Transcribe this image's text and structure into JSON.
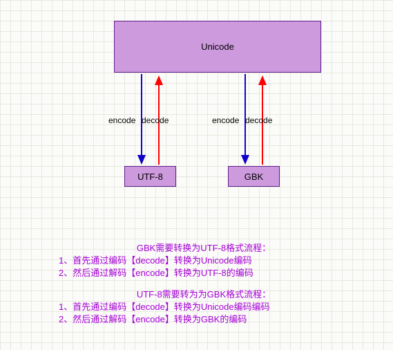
{
  "boxes": {
    "unicode": "Unicode",
    "utf8": "UTF-8",
    "gbk": "GBK"
  },
  "arrow_labels": {
    "encode_left": "encode",
    "decode_left": "decode",
    "encode_right": "encode",
    "decode_right": "decode"
  },
  "notes": {
    "section1_title": "GBK需要转换为UTF-8格式流程：",
    "section1_line1": "1、首先通过编码【decode】转换为Unicode编码",
    "section1_line2": "2、然后通过解码【encode】转换为UTF-8的编码",
    "section2_title": "UTF-8需要转为为GBK格式流程：",
    "section2_line1": "1、首先通过编码【decode】转换为Unicode编码编码",
    "section2_line2": "2、然后通过解码【encode】转换为GBK的编码"
  },
  "colors": {
    "encode_arrow": "#1100c9",
    "decode_arrow": "#ff0000",
    "box_fill": "#cd9ade",
    "box_border": "#5e1d8a",
    "note_text": "#a500d6"
  }
}
